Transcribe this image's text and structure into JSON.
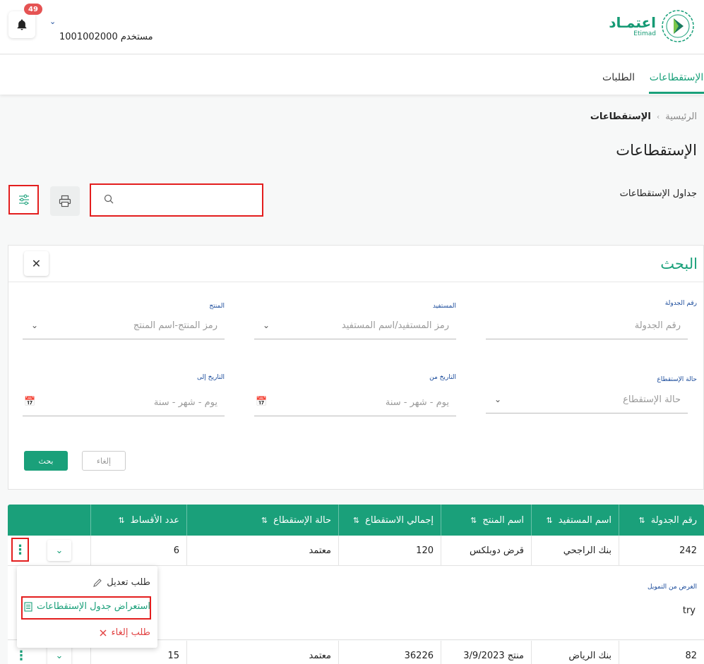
{
  "header": {
    "notification_count": "49",
    "user_label": "مستخدم 1001002000",
    "logo_ar": "اعتمـاد",
    "logo_en": "Etimad"
  },
  "tabs": [
    {
      "label": "الإستقطاعات",
      "active": true
    },
    {
      "label": "الطلبات",
      "active": false
    }
  ],
  "breadcrumb": {
    "home": "الرئيسية",
    "separator": "›",
    "current": "الإستقطاعات"
  },
  "page_title": "الإستقطاعات",
  "section_label": "جداول الإستقطاعات",
  "panel": {
    "title": "البحث",
    "close": "✕",
    "fields": {
      "schedule_no": {
        "label": "رقم الجدولة",
        "placeholder": "رقم الجدولة"
      },
      "beneficiary": {
        "label": "المستفيد",
        "placeholder": "رمز المستفيد/اسم المستفيد"
      },
      "product": {
        "label": "المنتج",
        "placeholder": "رمز المنتج-اسم المنتج"
      },
      "status": {
        "label": "حالة الإستقطاع",
        "placeholder": "حالة الإستقطاع"
      },
      "date_from": {
        "label": "التاريخ من",
        "placeholder": "يوم - شهر - سنة"
      },
      "date_to": {
        "label": "التاريخ إلى",
        "placeholder": "يوم - شهر - سنة"
      }
    },
    "search_button": "بحث",
    "cancel_button": "إلغاء"
  },
  "table": {
    "columns": [
      "رقم الجدولة",
      "اسم المستفيد",
      "اسم المنتج",
      "إجمالي الاستقطاع",
      "حالة الإستقطاع",
      "عدد الأقساط"
    ],
    "rows": [
      [
        "242",
        "بنك الراجحي",
        "قرض دوبلكس",
        "120",
        "معتمد",
        "6"
      ],
      [
        "82",
        "بنك الرياض",
        "منتج 3/9/2023",
        "36226",
        "معتمد",
        "15"
      ]
    ],
    "expanded": {
      "label": "الغرض من التمويل",
      "value": "try"
    }
  },
  "row_menu": [
    {
      "label": "طلب تعديل",
      "icon": "pencil-icon"
    },
    {
      "label": "استعراض جدول الإستقطاعات",
      "icon": "document-icon"
    },
    {
      "label": "طلب إلغاء",
      "icon": "close-icon"
    }
  ],
  "colors": {
    "accent": "#1aa07a",
    "highlight": "#e31e1e",
    "label_blue": "#1a4b9b"
  }
}
